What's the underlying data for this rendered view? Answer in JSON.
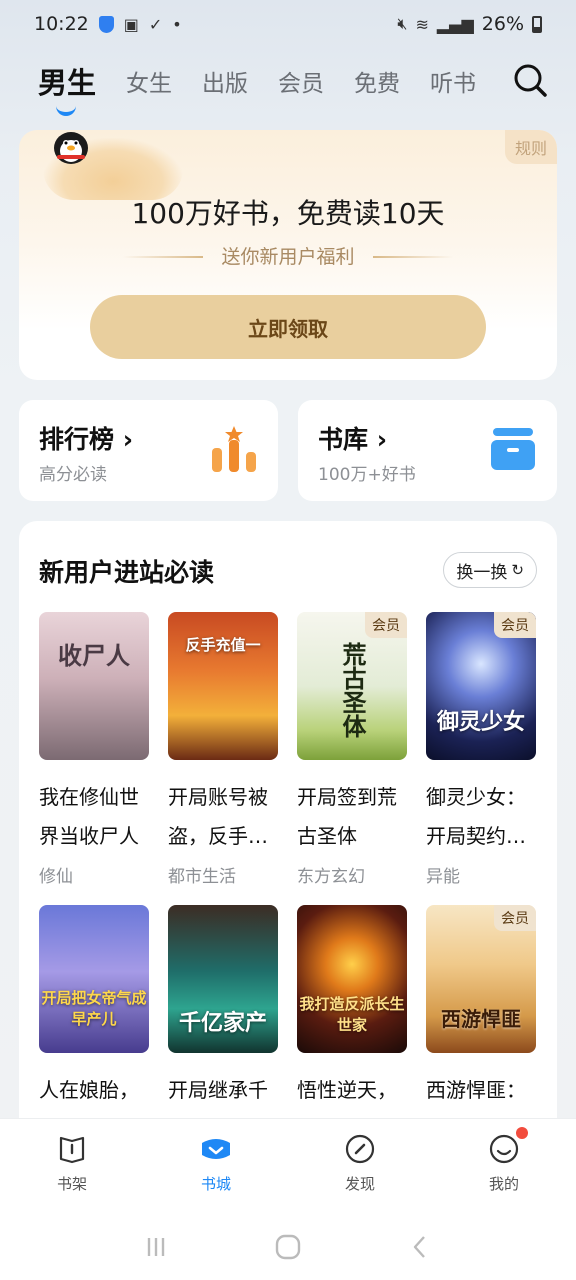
{
  "status": {
    "time": "10:22",
    "battery": "26%"
  },
  "tabs": [
    "男生",
    "女生",
    "出版",
    "会员",
    "免费",
    "听书"
  ],
  "promo": {
    "rule": "规则",
    "title": "100万好书，免费读10天",
    "subtitle": "送你新用户福利",
    "button": "立即领取"
  },
  "quick": {
    "rank": {
      "title": "排行榜",
      "sub": "高分必读"
    },
    "library": {
      "title": "书库",
      "sub": "100万+好书"
    }
  },
  "section": {
    "title": "新用户进站必读",
    "refresh": "换一换"
  },
  "vip_label": "会员",
  "books": [
    {
      "name": "我在修仙世界当收尸人",
      "cat": "修仙",
      "cover_text": "收尸人"
    },
    {
      "name": "开局账号被盗，反手…",
      "cat": "都市生活",
      "cover_text": "反手充值一"
    },
    {
      "name": "开局签到荒古圣体",
      "cat": "东方玄幻",
      "cover_text": "荒古圣体"
    },
    {
      "name": "御灵少女：开局契约…",
      "cat": "异能",
      "cover_text": "御灵少女"
    },
    {
      "name": "人在娘胎，开局…",
      "cat": "",
      "cover_text": "开局把女帝气成早产儿"
    },
    {
      "name": "开局继承千亿家产",
      "cat": "",
      "cover_text": "千亿家产"
    },
    {
      "name": "悟性逆天，我打造反…",
      "cat": "",
      "cover_text": "我打造反派长生世家"
    },
    {
      "name": "西游悍匪：从…",
      "cat": "",
      "cover_text": "西游悍匪"
    }
  ],
  "nav": [
    "书架",
    "书城",
    "发现",
    "我的"
  ]
}
